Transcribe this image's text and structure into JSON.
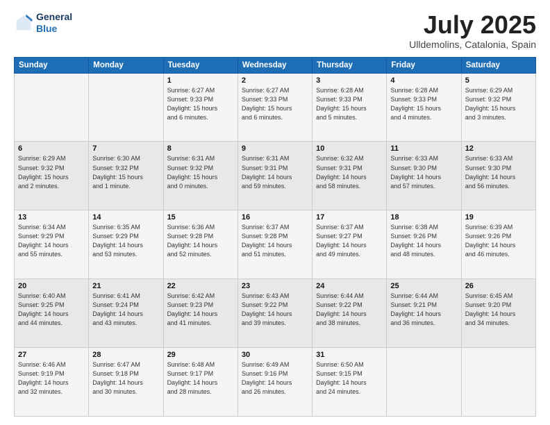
{
  "header": {
    "logo_line1": "General",
    "logo_line2": "Blue",
    "month": "July 2025",
    "location": "Ulldemolins, Catalonia, Spain"
  },
  "weekdays": [
    "Sunday",
    "Monday",
    "Tuesday",
    "Wednesday",
    "Thursday",
    "Friday",
    "Saturday"
  ],
  "weeks": [
    [
      {
        "day": "",
        "info": ""
      },
      {
        "day": "",
        "info": ""
      },
      {
        "day": "1",
        "info": "Sunrise: 6:27 AM\nSunset: 9:33 PM\nDaylight: 15 hours\nand 6 minutes."
      },
      {
        "day": "2",
        "info": "Sunrise: 6:27 AM\nSunset: 9:33 PM\nDaylight: 15 hours\nand 6 minutes."
      },
      {
        "day": "3",
        "info": "Sunrise: 6:28 AM\nSunset: 9:33 PM\nDaylight: 15 hours\nand 5 minutes."
      },
      {
        "day": "4",
        "info": "Sunrise: 6:28 AM\nSunset: 9:33 PM\nDaylight: 15 hours\nand 4 minutes."
      },
      {
        "day": "5",
        "info": "Sunrise: 6:29 AM\nSunset: 9:32 PM\nDaylight: 15 hours\nand 3 minutes."
      }
    ],
    [
      {
        "day": "6",
        "info": "Sunrise: 6:29 AM\nSunset: 9:32 PM\nDaylight: 15 hours\nand 2 minutes."
      },
      {
        "day": "7",
        "info": "Sunrise: 6:30 AM\nSunset: 9:32 PM\nDaylight: 15 hours\nand 1 minute."
      },
      {
        "day": "8",
        "info": "Sunrise: 6:31 AM\nSunset: 9:32 PM\nDaylight: 15 hours\nand 0 minutes."
      },
      {
        "day": "9",
        "info": "Sunrise: 6:31 AM\nSunset: 9:31 PM\nDaylight: 14 hours\nand 59 minutes."
      },
      {
        "day": "10",
        "info": "Sunrise: 6:32 AM\nSunset: 9:31 PM\nDaylight: 14 hours\nand 58 minutes."
      },
      {
        "day": "11",
        "info": "Sunrise: 6:33 AM\nSunset: 9:30 PM\nDaylight: 14 hours\nand 57 minutes."
      },
      {
        "day": "12",
        "info": "Sunrise: 6:33 AM\nSunset: 9:30 PM\nDaylight: 14 hours\nand 56 minutes."
      }
    ],
    [
      {
        "day": "13",
        "info": "Sunrise: 6:34 AM\nSunset: 9:29 PM\nDaylight: 14 hours\nand 55 minutes."
      },
      {
        "day": "14",
        "info": "Sunrise: 6:35 AM\nSunset: 9:29 PM\nDaylight: 14 hours\nand 53 minutes."
      },
      {
        "day": "15",
        "info": "Sunrise: 6:36 AM\nSunset: 9:28 PM\nDaylight: 14 hours\nand 52 minutes."
      },
      {
        "day": "16",
        "info": "Sunrise: 6:37 AM\nSunset: 9:28 PM\nDaylight: 14 hours\nand 51 minutes."
      },
      {
        "day": "17",
        "info": "Sunrise: 6:37 AM\nSunset: 9:27 PM\nDaylight: 14 hours\nand 49 minutes."
      },
      {
        "day": "18",
        "info": "Sunrise: 6:38 AM\nSunset: 9:26 PM\nDaylight: 14 hours\nand 48 minutes."
      },
      {
        "day": "19",
        "info": "Sunrise: 6:39 AM\nSunset: 9:26 PM\nDaylight: 14 hours\nand 46 minutes."
      }
    ],
    [
      {
        "day": "20",
        "info": "Sunrise: 6:40 AM\nSunset: 9:25 PM\nDaylight: 14 hours\nand 44 minutes."
      },
      {
        "day": "21",
        "info": "Sunrise: 6:41 AM\nSunset: 9:24 PM\nDaylight: 14 hours\nand 43 minutes."
      },
      {
        "day": "22",
        "info": "Sunrise: 6:42 AM\nSunset: 9:23 PM\nDaylight: 14 hours\nand 41 minutes."
      },
      {
        "day": "23",
        "info": "Sunrise: 6:43 AM\nSunset: 9:22 PM\nDaylight: 14 hours\nand 39 minutes."
      },
      {
        "day": "24",
        "info": "Sunrise: 6:44 AM\nSunset: 9:22 PM\nDaylight: 14 hours\nand 38 minutes."
      },
      {
        "day": "25",
        "info": "Sunrise: 6:44 AM\nSunset: 9:21 PM\nDaylight: 14 hours\nand 36 minutes."
      },
      {
        "day": "26",
        "info": "Sunrise: 6:45 AM\nSunset: 9:20 PM\nDaylight: 14 hours\nand 34 minutes."
      }
    ],
    [
      {
        "day": "27",
        "info": "Sunrise: 6:46 AM\nSunset: 9:19 PM\nDaylight: 14 hours\nand 32 minutes."
      },
      {
        "day": "28",
        "info": "Sunrise: 6:47 AM\nSunset: 9:18 PM\nDaylight: 14 hours\nand 30 minutes."
      },
      {
        "day": "29",
        "info": "Sunrise: 6:48 AM\nSunset: 9:17 PM\nDaylight: 14 hours\nand 28 minutes."
      },
      {
        "day": "30",
        "info": "Sunrise: 6:49 AM\nSunset: 9:16 PM\nDaylight: 14 hours\nand 26 minutes."
      },
      {
        "day": "31",
        "info": "Sunrise: 6:50 AM\nSunset: 9:15 PM\nDaylight: 14 hours\nand 24 minutes."
      },
      {
        "day": "",
        "info": ""
      },
      {
        "day": "",
        "info": ""
      }
    ]
  ]
}
